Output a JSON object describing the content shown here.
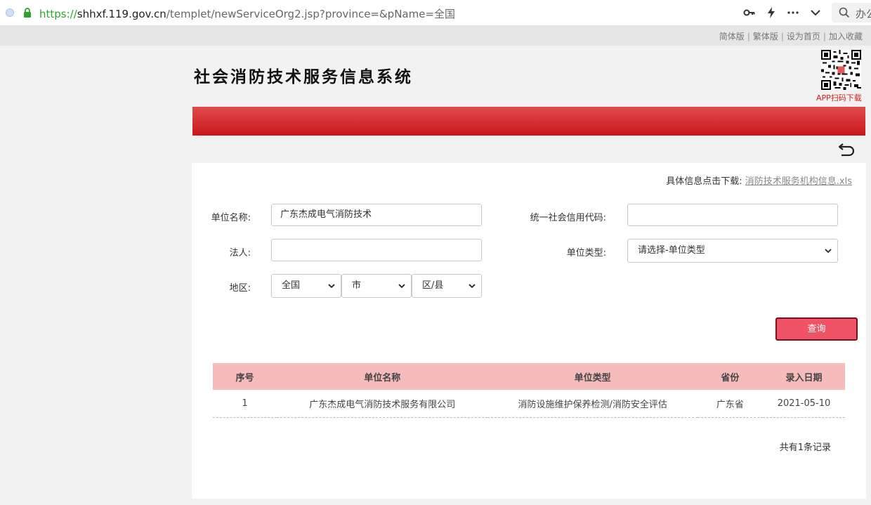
{
  "browser": {
    "url_scheme": "https://",
    "url_host": "shhxf.119.gov.cn",
    "url_rest": "/templet/newServiceOrg2.jsp?province=&pName=全国",
    "search_text": "办公"
  },
  "toplinks": {
    "simplified": "简体版",
    "traditional": "繁体版",
    "homepage": "设为首页",
    "favorite": "加入收藏",
    "separator": "|"
  },
  "header": {
    "title": "社会消防技术服务信息系统",
    "qr_caption": "APP扫码下载"
  },
  "download": {
    "prefix": "具体信息点击下载:",
    "link": "消防技术服务机构信息.xls"
  },
  "form": {
    "unit_name_label": "单位名称:",
    "unit_name_value": "广东杰成电气消防技术",
    "credit_code_label": "统一社会信用代码:",
    "credit_code_value": "",
    "legal_person_label": "法人:",
    "legal_person_value": "",
    "unit_type_label": "单位类型:",
    "unit_type_value": "请选择-单位类型",
    "region_label": "地区:",
    "province_value": "全国",
    "city_value": "市",
    "district_value": "区/县",
    "query_button": "查询"
  },
  "table": {
    "headers": [
      "序号",
      "单位名称",
      "单位类型",
      "省份",
      "录入日期"
    ],
    "rows": [
      [
        "1",
        "广东杰成电气消防技术服务有限公司",
        "消防设施维护保养检测/消防安全评估",
        "广东省",
        "2021-05-10"
      ]
    ]
  },
  "footer": {
    "total_text": "共有1条记录"
  },
  "colors": {
    "accent_red": "#c81818",
    "header_row": "#f6bcbc",
    "query_button": "#f05266"
  }
}
